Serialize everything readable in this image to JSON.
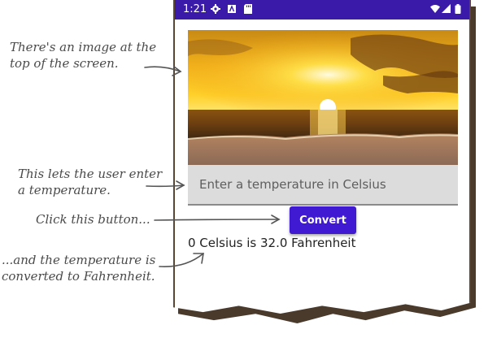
{
  "status_bar": {
    "time": "1:21"
  },
  "input": {
    "placeholder": "Enter a temperature in Celsius",
    "value": ""
  },
  "button": {
    "label": "Convert"
  },
  "result": {
    "text": "0 Celsius is 32.0 Fahrenheit"
  },
  "annotations": {
    "image_note": "There's an image at the top of the screen.",
    "input_note": "This lets the user enter a temperature.",
    "button_note": "Click this button...",
    "result_note": "...and the temperature is converted to Fahrenheit."
  },
  "colors": {
    "status_bar": "#3a1aa8",
    "button": "#3f1ad2",
    "input_bg": "#dcdcdc"
  },
  "icons": [
    "gear-icon",
    "a-icon",
    "sd-card-icon",
    "wifi-icon",
    "signal-icon",
    "battery-icon"
  ]
}
